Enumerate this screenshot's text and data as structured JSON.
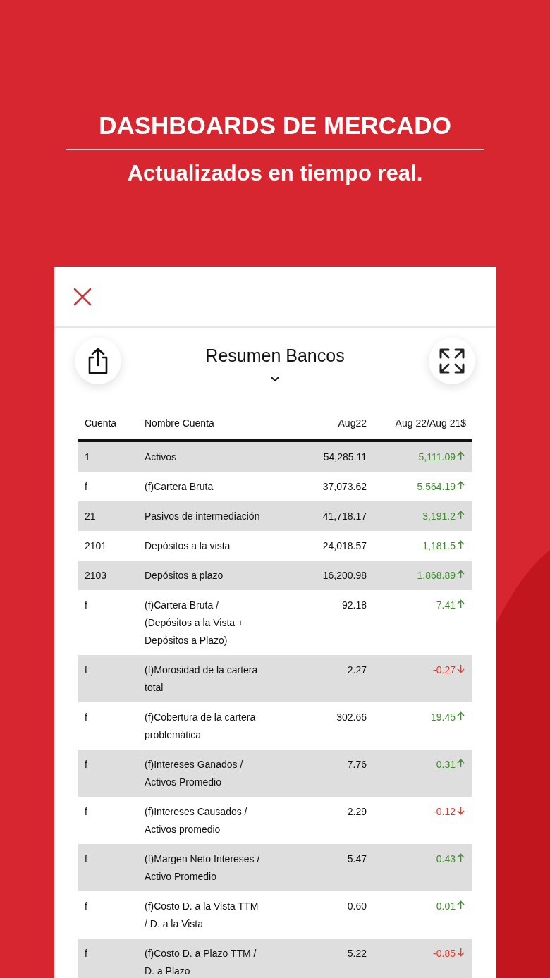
{
  "banner": {
    "title": "DASHBOARDS DE MERCADO",
    "subtitle": "Actualizados en tiempo real."
  },
  "report": {
    "title": "Resumen Bancos"
  },
  "table": {
    "columns": [
      "Cuenta",
      "Nombre Cuenta",
      "Aug22",
      "Aug 22/Aug 21$"
    ],
    "rows": [
      {
        "cuenta": "1",
        "nombre": "Activos",
        "value": "54,285.11",
        "change": "5,111.09",
        "kind": "up"
      },
      {
        "cuenta": "f",
        "nombre": "(f)Cartera Bruta",
        "value": "37,073.62",
        "change": "5,564.19",
        "kind": "up"
      },
      {
        "cuenta": "21",
        "nombre": "Pasivos de intermediación",
        "value": "41,718.17",
        "change": "3,191.2",
        "kind": "up"
      },
      {
        "cuenta": "2101",
        "nombre": "Depósitos a la vista",
        "value": "24,018.57",
        "change": "1,181.5",
        "kind": "up"
      },
      {
        "cuenta": "2103",
        "nombre": "Depósitos a plazo",
        "value": "16,200.98",
        "change": "1,868.89",
        "kind": "up"
      },
      {
        "cuenta": "f",
        "nombre": "(f)Cartera Bruta / (Depósitos a la Vista + Depósitos a Plazo)",
        "value": "92.18",
        "change": "7.41",
        "kind": "up"
      },
      {
        "cuenta": "f",
        "nombre": "(f)Morosidad de la cartera total",
        "value": "2.27",
        "change": "-0.27",
        "kind": "down"
      },
      {
        "cuenta": "f",
        "nombre": "(f)Cobertura de la cartera problemática",
        "value": "302.66",
        "change": "19.45",
        "kind": "up"
      },
      {
        "cuenta": "f",
        "nombre": "(f)Intereses Ganados / Activos Promedio",
        "value": "7.76",
        "change": "0.31",
        "kind": "up"
      },
      {
        "cuenta": "f",
        "nombre": "(f)Intereses Causados / Activos promedio",
        "value": "2.29",
        "change": "-0.12",
        "kind": "down"
      },
      {
        "cuenta": "f",
        "nombre": "(f)Margen Neto Intereses / Activo Promedio",
        "value": "5.47",
        "change": "0.43",
        "kind": "up"
      },
      {
        "cuenta": "f",
        "nombre": "(f)Costo D. a la Vista TTM / D. a la Vista",
        "value": "0.60",
        "change": "0.01",
        "kind": "up"
      },
      {
        "cuenta": "f",
        "nombre": "(f)Costo D. a Plazo TTM / D. a Plazo",
        "value": "5.22",
        "change": "-0.85",
        "kind": "down"
      }
    ]
  }
}
